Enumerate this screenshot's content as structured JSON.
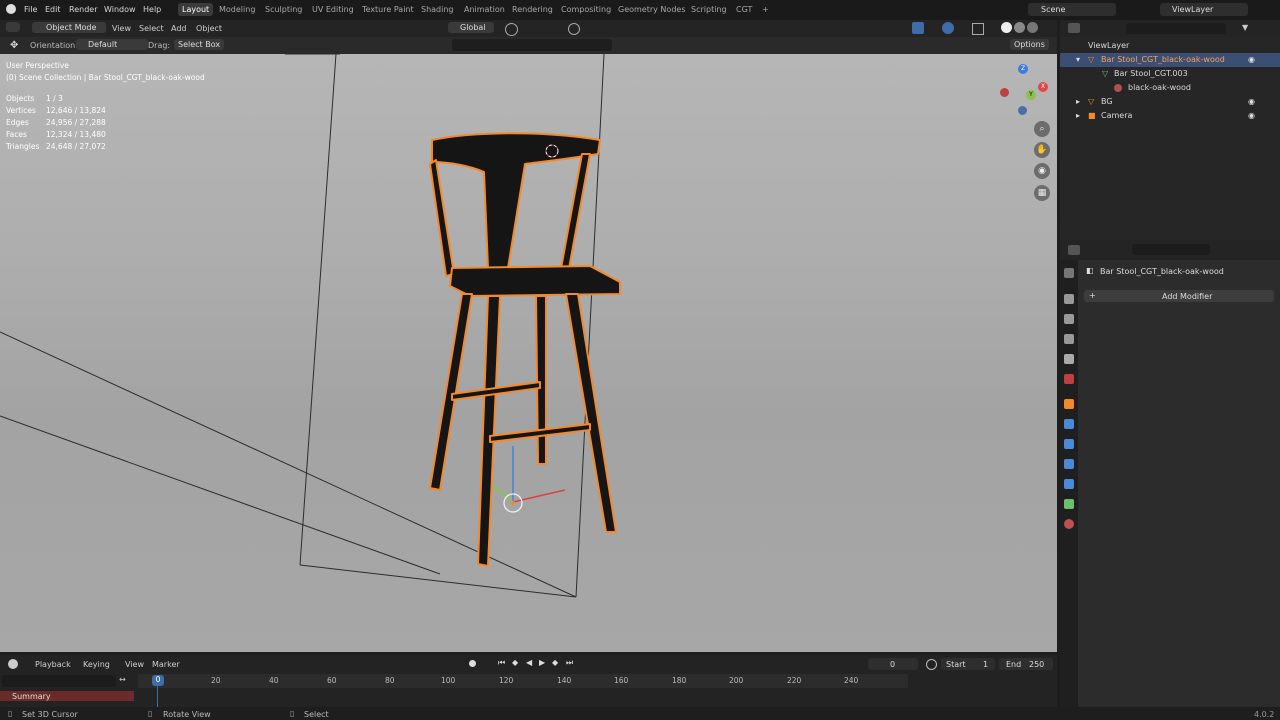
{
  "menubar": {
    "items": [
      "File",
      "Edit",
      "Render",
      "Window",
      "Help"
    ],
    "workspace_tabs": [
      "Layout",
      "Modeling",
      "Sculpting",
      "UV Editing",
      "Texture Paint",
      "Shading",
      "Animation",
      "Rendering",
      "Compositing",
      "Geometry Nodes",
      "Scripting",
      "CGT"
    ],
    "active_tab": "Layout",
    "add_tab": "+",
    "scene": "Scene",
    "view_layer": "ViewLayer"
  },
  "viewport_header": {
    "mode": "Object Mode",
    "menus": [
      "View",
      "Select",
      "Add",
      "Object"
    ],
    "transform": "Global"
  },
  "tool_header": {
    "orientation_label": "Orientation:",
    "orientation_value": "Default",
    "drag_label": "Drag:",
    "drag_value": "Select Box",
    "options": "Options"
  },
  "overlay": {
    "perspective": "User Perspective",
    "collection": "(0) Scene Collection | Bar Stool_CGT_black-oak-wood",
    "stats": [
      {
        "label": "Objects",
        "value": "1 / 3"
      },
      {
        "label": "Vertices",
        "value": "12,646 / 13,824"
      },
      {
        "label": "Edges",
        "value": "24,956 / 27,288"
      },
      {
        "label": "Faces",
        "value": "12,324 / 13,480"
      },
      {
        "label": "Triangles",
        "value": "24,648 / 27,072"
      }
    ]
  },
  "gizmo": {
    "x": "X",
    "y": "Y",
    "z": "Z"
  },
  "outliner": {
    "root": "ViewLayer",
    "rows": [
      {
        "label": "Bar Stool_CGT_black-oak-wood",
        "selected": true
      },
      {
        "label": "Bar Stool_CGT.003",
        "selected": false
      },
      {
        "label": "black-oak-wood",
        "selected": false
      },
      {
        "label": "BG",
        "selected": false
      },
      {
        "label": "Camera",
        "selected": false
      }
    ]
  },
  "properties": {
    "object_name": "Bar Stool_CGT_black-oak-wood",
    "add_modifier": "Add Modifier"
  },
  "timeline": {
    "menus": [
      "Playback",
      "Keying",
      "View",
      "Marker"
    ],
    "current_frame": "0",
    "start_label": "Start",
    "start": "1",
    "end_label": "End",
    "end": "250",
    "playhead": "0",
    "ticks": [
      "20",
      "40",
      "60",
      "80",
      "100",
      "120",
      "140",
      "160",
      "180",
      "200",
      "220",
      "240"
    ],
    "summary": "Summary"
  },
  "statusbar": {
    "left": "Set 3D Cursor",
    "middle": "Rotate View",
    "right_action": "Select",
    "version": "4.0.2"
  },
  "colors": {
    "selection_outline": "#f5892a",
    "blender_orange": "#f5792a",
    "blender_blue": "#265787",
    "active_tab": "#3b3b3b"
  }
}
